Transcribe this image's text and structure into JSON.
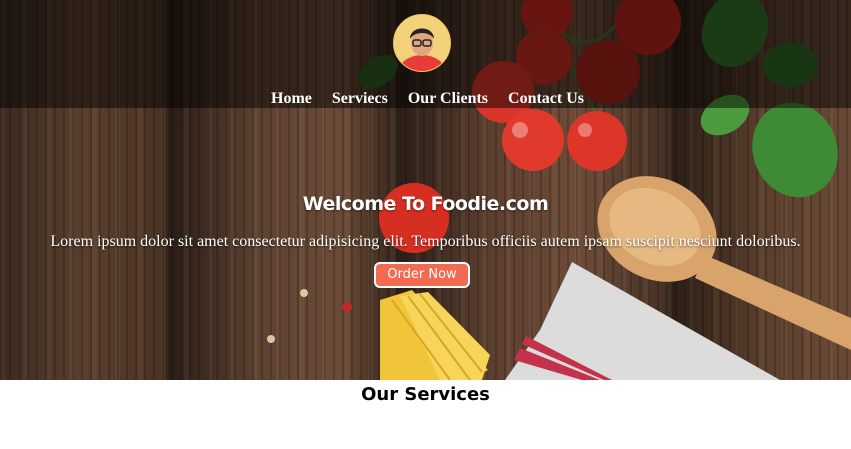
{
  "nav": {
    "items": [
      {
        "label": "Home"
      },
      {
        "label": "Serviecs"
      },
      {
        "label": "Our Clients"
      },
      {
        "label": "Contact Us"
      }
    ]
  },
  "hero": {
    "title": "Welcome To Foodie.com",
    "text": "Lorem ipsum dolor sit amet consectetur adipisicing elit. Temporibus officiis autem ipsam suscipit nesciunt doloribus.",
    "button_label": "Order Now"
  },
  "services": {
    "title": "Our Services"
  },
  "colors": {
    "accent": "#f26a4f",
    "text_light": "#ffffff",
    "overlay": "rgba(0,0,0,0.48)"
  }
}
